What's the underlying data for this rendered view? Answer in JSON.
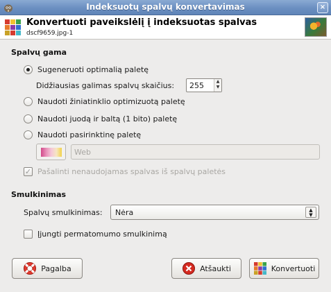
{
  "window": {
    "title": "Indeksuotų spalvų konvertavimas",
    "close_glyph": "×"
  },
  "header": {
    "title": "Konvertuoti paveikslėlį į indeksuotas spalvas",
    "subtitle": "dscf9659.jpg-1"
  },
  "palette_section": {
    "label": "Spalvų gama",
    "options": [
      {
        "label": "Sugeneruoti optimalią paletę",
        "checked": true
      },
      {
        "label": "Naudoti žiniatinklio optimizuotą paletę",
        "checked": false
      },
      {
        "label": "Naudoti juodą ir baltą (1 bito) paletę",
        "checked": false
      },
      {
        "label": "Naudoti pasirinktinę paletę",
        "checked": false
      }
    ],
    "max_colors_label": "Didžiausias galimas spalvų skaičius:",
    "max_colors_value": "255",
    "custom_palette_value": "Web",
    "remove_unused_label": "Pašalinti nenaudojamas spalvas iš spalvų paletės"
  },
  "dither_section": {
    "label": "Smulkinimas",
    "color_dither_label": "Spalvų smulkinimas:",
    "color_dither_value": "Nėra",
    "transparency_label": "Įjungti permatomumo smulkinimą"
  },
  "buttons": {
    "help": "Pagalba",
    "cancel": "Atšaukti",
    "convert": "Konvertuoti"
  }
}
